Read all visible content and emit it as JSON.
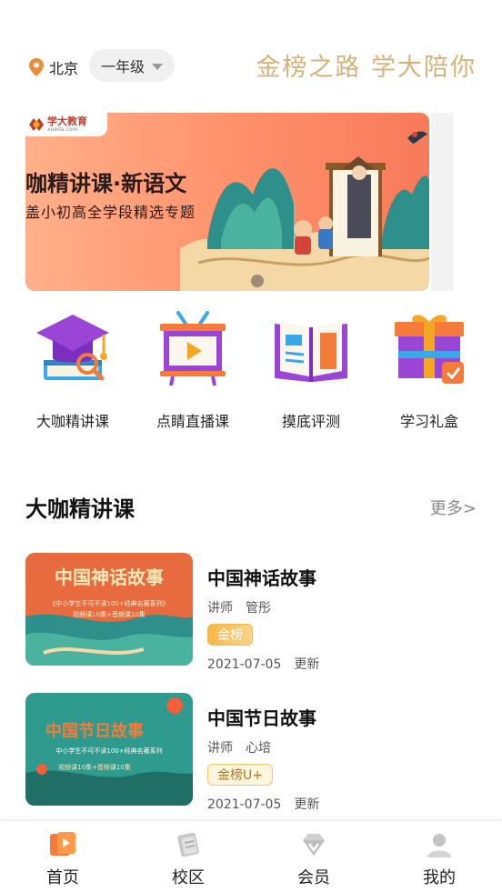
{
  "header": {
    "location": "北京",
    "grade": "一年级",
    "slogan": "金榜之路 学大陪你"
  },
  "banner": {
    "brand_name": "学大教育",
    "brand_domain": "xueda.com",
    "title": "咖精讲课·新语文",
    "subtitle": "盖小初高全学段精选专题"
  },
  "quick_nav": [
    {
      "label": "大咖精讲课",
      "icon": "graduation-cap-icon"
    },
    {
      "label": "点睛直播课",
      "icon": "live-tv-icon"
    },
    {
      "label": "摸底评测",
      "icon": "open-book-icon"
    },
    {
      "label": "学习礼盒",
      "icon": "gift-box-icon"
    }
  ],
  "section": {
    "title": "大咖精讲课",
    "more": "更多>"
  },
  "courses": [
    {
      "title": "中国神话故事",
      "teacher_label": "讲师",
      "teacher": "管彤",
      "badge": "金榜",
      "date": "2021-07-05",
      "status": "更新",
      "thumb_title": "中国神话故事",
      "thumb_sub1": "《中小学生不可不读100+经典名著系列》",
      "thumb_sub2": "视频课10集+音频课10集"
    },
    {
      "title": "中国节日故事",
      "teacher_label": "讲师",
      "teacher": "心培",
      "badge": "金榜U+",
      "date": "2021-07-05",
      "status": "更新",
      "thumb_title": "中国节日故事",
      "thumb_sub1": "中小学生不可不读100+经典名著系列",
      "thumb_sub2": "视频课10集+音频课10集"
    }
  ],
  "tabs": [
    {
      "label": "首页",
      "icon": "home-icon",
      "active": true
    },
    {
      "label": "校区",
      "icon": "campus-icon",
      "active": false
    },
    {
      "label": "会员",
      "icon": "diamond-icon",
      "active": false
    },
    {
      "label": "我的",
      "icon": "user-icon",
      "active": false
    }
  ],
  "colors": {
    "accent_orange": "#f57b3a",
    "gold": "#d5b27a",
    "purple": "#8a3cc8"
  }
}
